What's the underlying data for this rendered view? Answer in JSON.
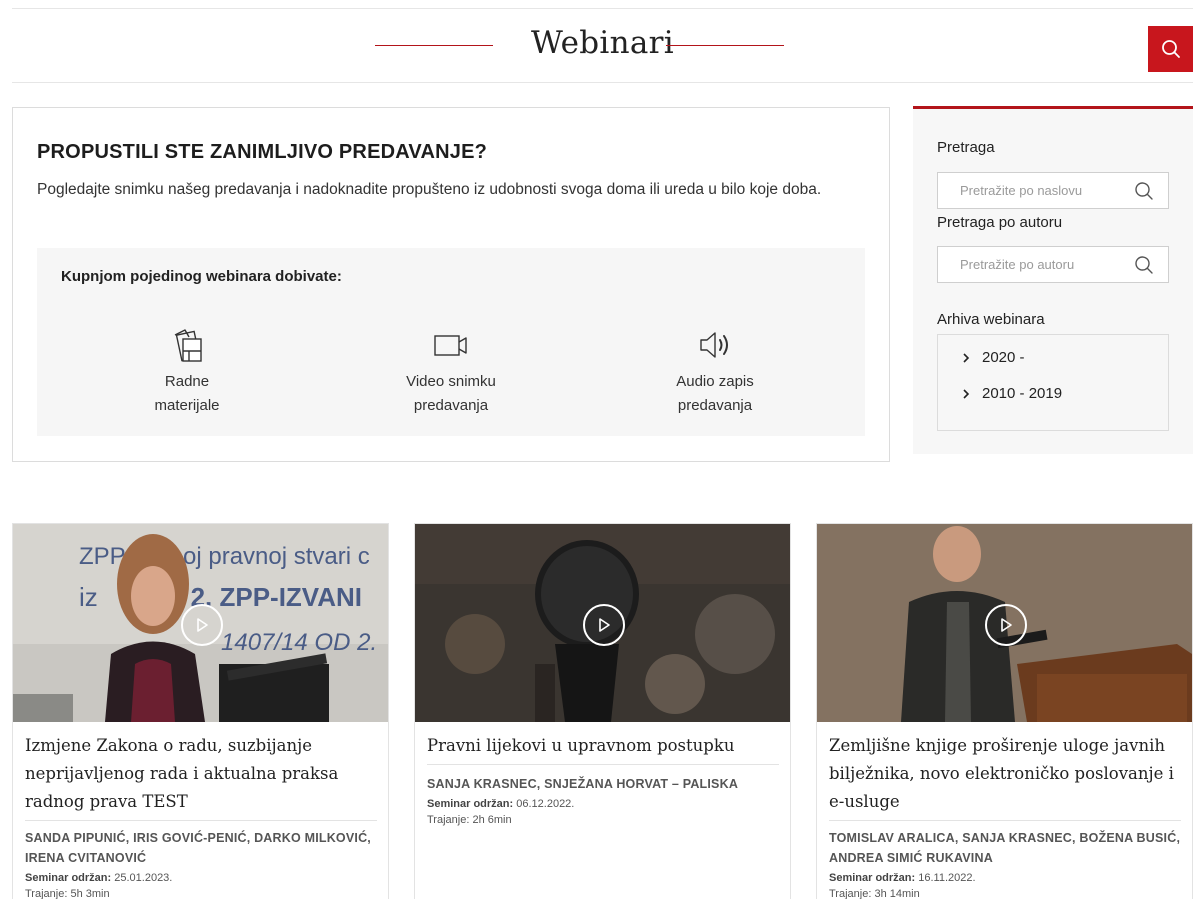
{
  "header": {
    "title": "Webinari"
  },
  "promo": {
    "heading": "PROPUSTILI STE ZANIMLJIVO PREDAVANJE?",
    "text": "Pogledajte snimku našeg predavanja i nadoknadite propušteno iz udobnosti svoga doma ili ureda u bilo koje doba.",
    "benefits_heading": "Kupnjom pojedinog webinara dobivate:",
    "benefits": [
      {
        "icon": "documents-icon",
        "line1": "Radne",
        "line2": "materijale"
      },
      {
        "icon": "video-camera-icon",
        "line1": "Video snimku",
        "line2": "predavanja"
      },
      {
        "icon": "speaker-icon",
        "line1": "Audio zapis",
        "line2": "predavanja"
      }
    ]
  },
  "sidebar": {
    "search_label": "Pretraga",
    "search_placeholder": "Pretražite po naslovu",
    "author_label": "Pretraga po autoru",
    "author_placeholder": "Pretražite po autoru",
    "archive_label": "Arhiva webinara",
    "archive_items": [
      "2020 -",
      "2010 - 2019"
    ]
  },
  "cards": [
    {
      "title": "Izmjene Zakona o radu, suzbijanje neprijavljenog rada i aktualna praksa radnog prava TEST",
      "authors": "SANDA PIPUNIĆ, IRIS GOVIĆ-PENIĆ, DARKO MILKOVIĆ, IRENA CVITANOVIĆ",
      "held_label": "Seminar održan:",
      "held_date": "25.01.2023.",
      "duration": "Trajanje: 5h 3min",
      "slide_text": [
        "ZPP",
        "oj pravnoj stvari c",
        "iz",
        "st. 2. ZPP-IZVANI",
        "1407/14 OD 2."
      ]
    },
    {
      "title": "Pravni lijekovi u upravnom postupku",
      "authors": "SANJA KRASNEC, SNJEŽANA HORVAT – PALISKA",
      "held_label": "Seminar održan:",
      "held_date": "06.12.2022.",
      "duration": "Trajanje: 2h 6min"
    },
    {
      "title": "Zemljišne knjige proširenje uloge javnih bilježnika, novo elektroničko poslovanje i e-usluge",
      "authors": "TOMISLAV ARALICA, SANJA KRASNEC, BOŽENA BUSIĆ, ANDREA SIMIĆ RUKAVINA",
      "held_label": "Seminar održan:",
      "held_date": "16.11.2022.",
      "duration": "Trajanje: 3h 14min"
    }
  ],
  "colors": {
    "accent": "#c8161d",
    "accent_line": "#b3141a"
  }
}
